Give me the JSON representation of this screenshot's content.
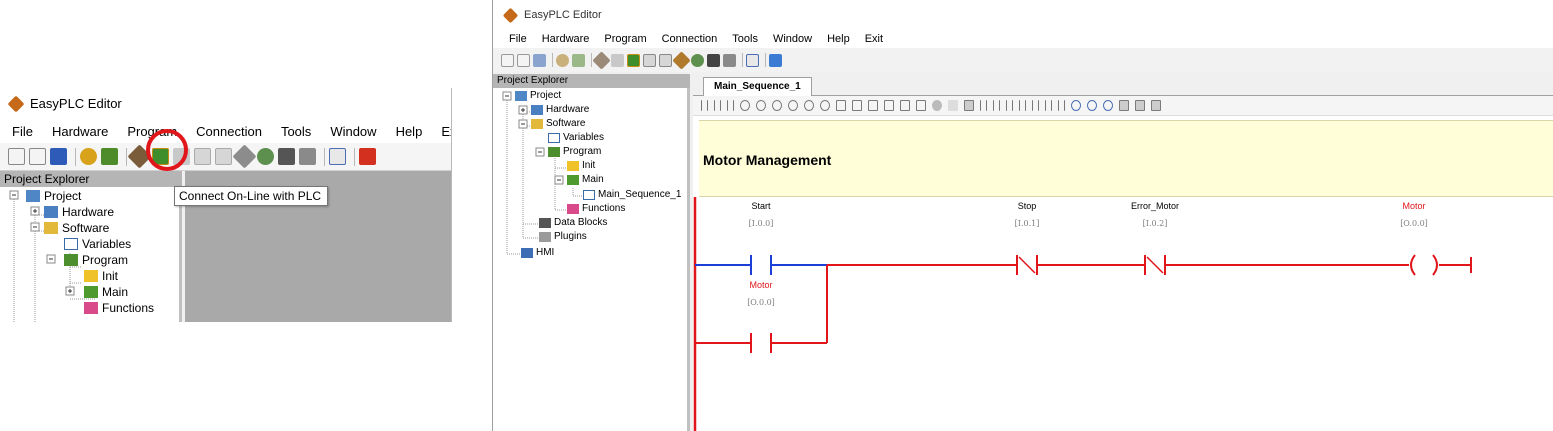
{
  "window_small": {
    "title": "EasyPLC Editor",
    "menu": [
      "File",
      "Hardware",
      "Program",
      "Connection",
      "Tools",
      "Window",
      "Help",
      "Exit"
    ],
    "explorer_header": "Project Explorer",
    "tree": [
      "Project",
      "Hardware",
      "Software",
      "Variables",
      "Program",
      "Init",
      "Main",
      "Functions"
    ],
    "tooltip": "Connect On-Line with PLC"
  },
  "window_large": {
    "title": "EasyPLC Editor",
    "menu": [
      "File",
      "Hardware",
      "Program",
      "Connection",
      "Tools",
      "Window",
      "Help",
      "Exit"
    ],
    "explorer_header": "Project Explorer",
    "tree": [
      "Project",
      "Hardware",
      "Software",
      "Variables",
      "Program",
      "Init",
      "Main",
      "Main_Sequence_1",
      "Functions",
      "Data Blocks",
      "Plugins",
      "HMI"
    ],
    "tab": "Main_Sequence_1",
    "network_title": "Motor Management",
    "ladder": {
      "start": {
        "name": "Start",
        "addr": "[I.0.0]"
      },
      "stop": {
        "name": "Stop",
        "addr": "[I.0.1]"
      },
      "error": {
        "name": "Error_Motor",
        "addr": "[I.0.2]"
      },
      "coil": {
        "name": "Motor",
        "addr": "[O.0.0]"
      },
      "seal": {
        "name": "Motor",
        "addr": "[O.0.0]"
      }
    }
  },
  "colors": {
    "energized": "#e0161b",
    "active_contact": "#1c3fd8",
    "highlight": "#e0161b"
  }
}
